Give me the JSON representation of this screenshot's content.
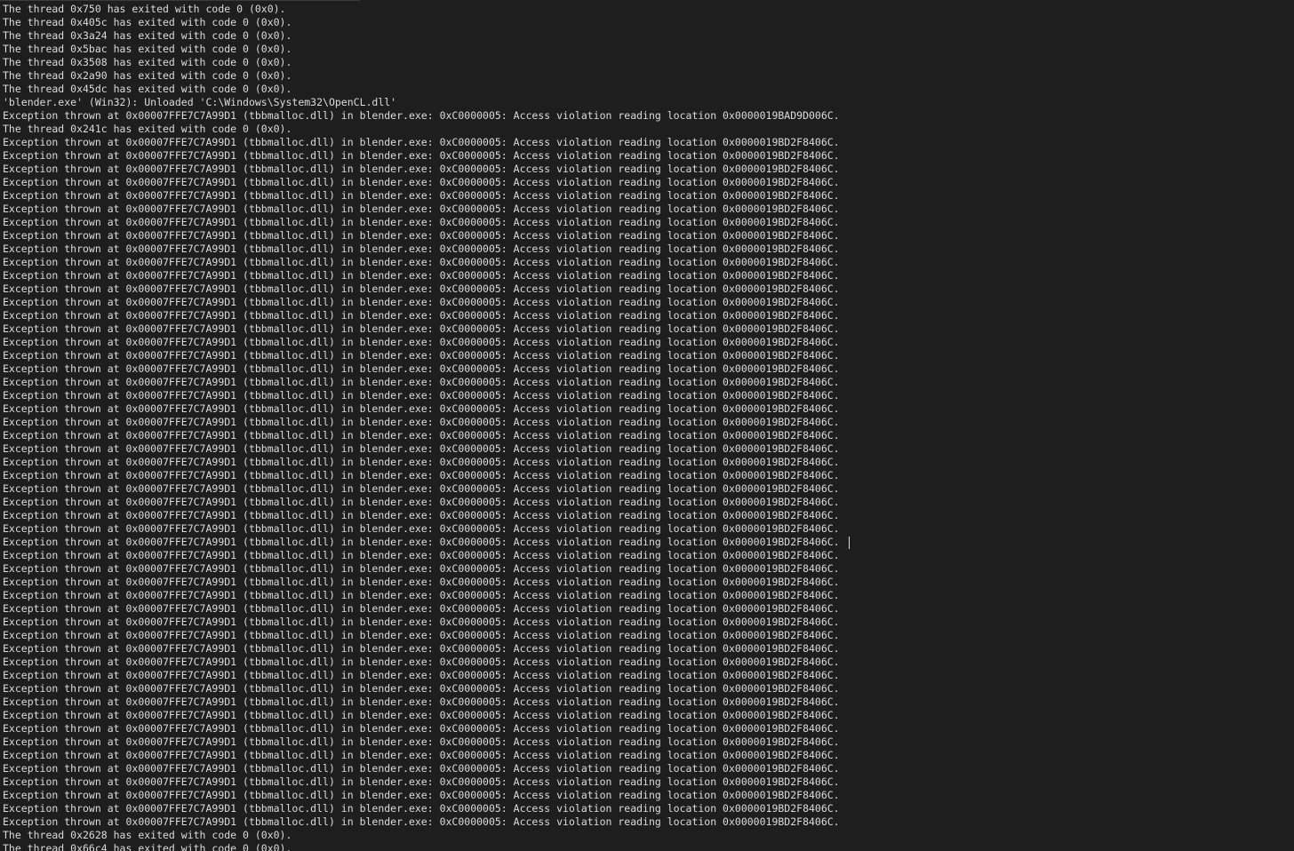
{
  "output_lines": [
    "The thread 0x750 has exited with code 0 (0x0).",
    "The thread 0x405c has exited with code 0 (0x0).",
    "The thread 0x3a24 has exited with code 0 (0x0).",
    "The thread 0x5bac has exited with code 0 (0x0).",
    "The thread 0x3508 has exited with code 0 (0x0).",
    "The thread 0x2a90 has exited with code 0 (0x0).",
    "The thread 0x45dc has exited with code 0 (0x0).",
    "'blender.exe' (Win32): Unloaded 'C:\\Windows\\System32\\OpenCL.dll'",
    "Exception thrown at 0x00007FFE7C7A99D1 (tbbmalloc.dll) in blender.exe: 0xC0000005: Access violation reading location 0x0000019BAD9D006C.",
    "The thread 0x241c has exited with code 0 (0x0).",
    "Exception thrown at 0x00007FFE7C7A99D1 (tbbmalloc.dll) in blender.exe: 0xC0000005: Access violation reading location 0x0000019BD2F8406C.",
    "Exception thrown at 0x00007FFE7C7A99D1 (tbbmalloc.dll) in blender.exe: 0xC0000005: Access violation reading location 0x0000019BD2F8406C.",
    "Exception thrown at 0x00007FFE7C7A99D1 (tbbmalloc.dll) in blender.exe: 0xC0000005: Access violation reading location 0x0000019BD2F8406C.",
    "Exception thrown at 0x00007FFE7C7A99D1 (tbbmalloc.dll) in blender.exe: 0xC0000005: Access violation reading location 0x0000019BD2F8406C.",
    "Exception thrown at 0x00007FFE7C7A99D1 (tbbmalloc.dll) in blender.exe: 0xC0000005: Access violation reading location 0x0000019BD2F8406C.",
    "Exception thrown at 0x00007FFE7C7A99D1 (tbbmalloc.dll) in blender.exe: 0xC0000005: Access violation reading location 0x0000019BD2F8406C.",
    "Exception thrown at 0x00007FFE7C7A99D1 (tbbmalloc.dll) in blender.exe: 0xC0000005: Access violation reading location 0x0000019BD2F8406C.",
    "Exception thrown at 0x00007FFE7C7A99D1 (tbbmalloc.dll) in blender.exe: 0xC0000005: Access violation reading location 0x0000019BD2F8406C.",
    "Exception thrown at 0x00007FFE7C7A99D1 (tbbmalloc.dll) in blender.exe: 0xC0000005: Access violation reading location 0x0000019BD2F8406C.",
    "Exception thrown at 0x00007FFE7C7A99D1 (tbbmalloc.dll) in blender.exe: 0xC0000005: Access violation reading location 0x0000019BD2F8406C.",
    "Exception thrown at 0x00007FFE7C7A99D1 (tbbmalloc.dll) in blender.exe: 0xC0000005: Access violation reading location 0x0000019BD2F8406C.",
    "Exception thrown at 0x00007FFE7C7A99D1 (tbbmalloc.dll) in blender.exe: 0xC0000005: Access violation reading location 0x0000019BD2F8406C.",
    "Exception thrown at 0x00007FFE7C7A99D1 (tbbmalloc.dll) in blender.exe: 0xC0000005: Access violation reading location 0x0000019BD2F8406C.",
    "Exception thrown at 0x00007FFE7C7A99D1 (tbbmalloc.dll) in blender.exe: 0xC0000005: Access violation reading location 0x0000019BD2F8406C.",
    "Exception thrown at 0x00007FFE7C7A99D1 (tbbmalloc.dll) in blender.exe: 0xC0000005: Access violation reading location 0x0000019BD2F8406C.",
    "Exception thrown at 0x00007FFE7C7A99D1 (tbbmalloc.dll) in blender.exe: 0xC0000005: Access violation reading location 0x0000019BD2F8406C.",
    "Exception thrown at 0x00007FFE7C7A99D1 (tbbmalloc.dll) in blender.exe: 0xC0000005: Access violation reading location 0x0000019BD2F8406C.",
    "Exception thrown at 0x00007FFE7C7A99D1 (tbbmalloc.dll) in blender.exe: 0xC0000005: Access violation reading location 0x0000019BD2F8406C.",
    "Exception thrown at 0x00007FFE7C7A99D1 (tbbmalloc.dll) in blender.exe: 0xC0000005: Access violation reading location 0x0000019BD2F8406C.",
    "Exception thrown at 0x00007FFE7C7A99D1 (tbbmalloc.dll) in blender.exe: 0xC0000005: Access violation reading location 0x0000019BD2F8406C.",
    "Exception thrown at 0x00007FFE7C7A99D1 (tbbmalloc.dll) in blender.exe: 0xC0000005: Access violation reading location 0x0000019BD2F8406C.",
    "Exception thrown at 0x00007FFE7C7A99D1 (tbbmalloc.dll) in blender.exe: 0xC0000005: Access violation reading location 0x0000019BD2F8406C.",
    "Exception thrown at 0x00007FFE7C7A99D1 (tbbmalloc.dll) in blender.exe: 0xC0000005: Access violation reading location 0x0000019BD2F8406C.",
    "Exception thrown at 0x00007FFE7C7A99D1 (tbbmalloc.dll) in blender.exe: 0xC0000005: Access violation reading location 0x0000019BD2F8406C.",
    "Exception thrown at 0x00007FFE7C7A99D1 (tbbmalloc.dll) in blender.exe: 0xC0000005: Access violation reading location 0x0000019BD2F8406C.",
    "Exception thrown at 0x00007FFE7C7A99D1 (tbbmalloc.dll) in blender.exe: 0xC0000005: Access violation reading location 0x0000019BD2F8406C.",
    "Exception thrown at 0x00007FFE7C7A99D1 (tbbmalloc.dll) in blender.exe: 0xC0000005: Access violation reading location 0x0000019BD2F8406C.",
    "Exception thrown at 0x00007FFE7C7A99D1 (tbbmalloc.dll) in blender.exe: 0xC0000005: Access violation reading location 0x0000019BD2F8406C.",
    "Exception thrown at 0x00007FFE7C7A99D1 (tbbmalloc.dll) in blender.exe: 0xC0000005: Access violation reading location 0x0000019BD2F8406C.",
    "Exception thrown at 0x00007FFE7C7A99D1 (tbbmalloc.dll) in blender.exe: 0xC0000005: Access violation reading location 0x0000019BD2F8406C.",
    "Exception thrown at 0x00007FFE7C7A99D1 (tbbmalloc.dll) in blender.exe: 0xC0000005: Access violation reading location 0x0000019BD2F8406C.",
    "Exception thrown at 0x00007FFE7C7A99D1 (tbbmalloc.dll) in blender.exe: 0xC0000005: Access violation reading location 0x0000019BD2F8406C.",
    "Exception thrown at 0x00007FFE7C7A99D1 (tbbmalloc.dll) in blender.exe: 0xC0000005: Access violation reading location 0x0000019BD2F8406C.",
    "Exception thrown at 0x00007FFE7C7A99D1 (tbbmalloc.dll) in blender.exe: 0xC0000005: Access violation reading location 0x0000019BD2F8406C.",
    "Exception thrown at 0x00007FFE7C7A99D1 (tbbmalloc.dll) in blender.exe: 0xC0000005: Access violation reading location 0x0000019BD2F8406C.",
    "Exception thrown at 0x00007FFE7C7A99D1 (tbbmalloc.dll) in blender.exe: 0xC0000005: Access violation reading location 0x0000019BD2F8406C.",
    "Exception thrown at 0x00007FFE7C7A99D1 (tbbmalloc.dll) in blender.exe: 0xC0000005: Access violation reading location 0x0000019BD2F8406C.",
    "Exception thrown at 0x00007FFE7C7A99D1 (tbbmalloc.dll) in blender.exe: 0xC0000005: Access violation reading location 0x0000019BD2F8406C.",
    "Exception thrown at 0x00007FFE7C7A99D1 (tbbmalloc.dll) in blender.exe: 0xC0000005: Access violation reading location 0x0000019BD2F8406C.",
    "Exception thrown at 0x00007FFE7C7A99D1 (tbbmalloc.dll) in blender.exe: 0xC0000005: Access violation reading location 0x0000019BD2F8406C.",
    "Exception thrown at 0x00007FFE7C7A99D1 (tbbmalloc.dll) in blender.exe: 0xC0000005: Access violation reading location 0x0000019BD2F8406C.",
    "Exception thrown at 0x00007FFE7C7A99D1 (tbbmalloc.dll) in blender.exe: 0xC0000005: Access violation reading location 0x0000019BD2F8406C.",
    "Exception thrown at 0x00007FFE7C7A99D1 (tbbmalloc.dll) in blender.exe: 0xC0000005: Access violation reading location 0x0000019BD2F8406C.",
    "Exception thrown at 0x00007FFE7C7A99D1 (tbbmalloc.dll) in blender.exe: 0xC0000005: Access violation reading location 0x0000019BD2F8406C.",
    "Exception thrown at 0x00007FFE7C7A99D1 (tbbmalloc.dll) in blender.exe: 0xC0000005: Access violation reading location 0x0000019BD2F8406C.",
    "Exception thrown at 0x00007FFE7C7A99D1 (tbbmalloc.dll) in blender.exe: 0xC0000005: Access violation reading location 0x0000019BD2F8406C.",
    "Exception thrown at 0x00007FFE7C7A99D1 (tbbmalloc.dll) in blender.exe: 0xC0000005: Access violation reading location 0x0000019BD2F8406C.",
    "Exception thrown at 0x00007FFE7C7A99D1 (tbbmalloc.dll) in blender.exe: 0xC0000005: Access violation reading location 0x0000019BD2F8406C.",
    "Exception thrown at 0x00007FFE7C7A99D1 (tbbmalloc.dll) in blender.exe: 0xC0000005: Access violation reading location 0x0000019BD2F8406C.",
    "Exception thrown at 0x00007FFE7C7A99D1 (tbbmalloc.dll) in blender.exe: 0xC0000005: Access violation reading location 0x0000019BD2F8406C.",
    "Exception thrown at 0x00007FFE7C7A99D1 (tbbmalloc.dll) in blender.exe: 0xC0000005: Access violation reading location 0x0000019BD2F8406C.",
    "Exception thrown at 0x00007FFE7C7A99D1 (tbbmalloc.dll) in blender.exe: 0xC0000005: Access violation reading location 0x0000019BD2F8406C.",
    "The thread 0x2628 has exited with code 0 (0x0).",
    "The thread 0x66c4 has exited with code 0 (0x0)."
  ],
  "text_cursor_line": 40,
  "colors": {
    "background": "#1e1e1e",
    "text": "#dcdcdc"
  }
}
